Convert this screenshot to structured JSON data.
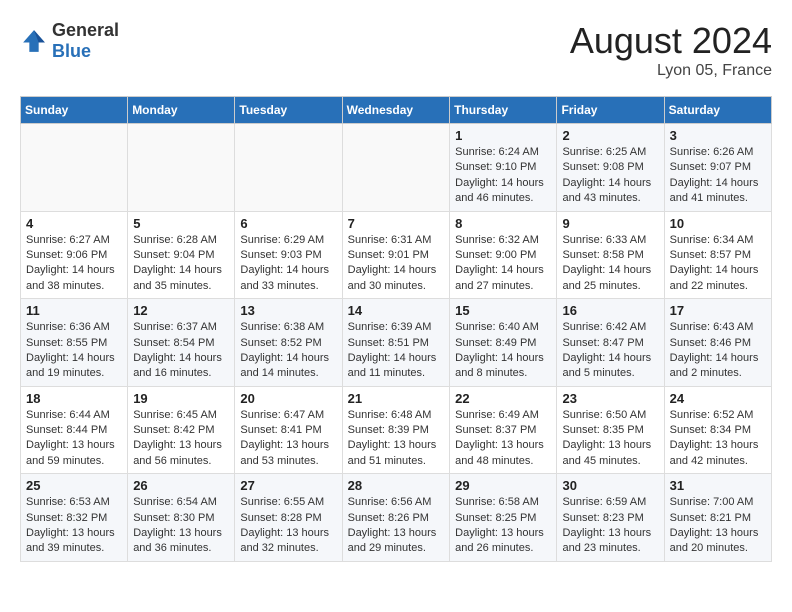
{
  "header": {
    "logo_general": "General",
    "logo_blue": "Blue",
    "month": "August 2024",
    "location": "Lyon 05, France"
  },
  "weekdays": [
    "Sunday",
    "Monday",
    "Tuesday",
    "Wednesday",
    "Thursday",
    "Friday",
    "Saturday"
  ],
  "weeks": [
    [
      {
        "day": "",
        "info": ""
      },
      {
        "day": "",
        "info": ""
      },
      {
        "day": "",
        "info": ""
      },
      {
        "day": "",
        "info": ""
      },
      {
        "day": "1",
        "info": "Sunrise: 6:24 AM\nSunset: 9:10 PM\nDaylight: 14 hours\nand 46 minutes."
      },
      {
        "day": "2",
        "info": "Sunrise: 6:25 AM\nSunset: 9:08 PM\nDaylight: 14 hours\nand 43 minutes."
      },
      {
        "day": "3",
        "info": "Sunrise: 6:26 AM\nSunset: 9:07 PM\nDaylight: 14 hours\nand 41 minutes."
      }
    ],
    [
      {
        "day": "4",
        "info": "Sunrise: 6:27 AM\nSunset: 9:06 PM\nDaylight: 14 hours\nand 38 minutes."
      },
      {
        "day": "5",
        "info": "Sunrise: 6:28 AM\nSunset: 9:04 PM\nDaylight: 14 hours\nand 35 minutes."
      },
      {
        "day": "6",
        "info": "Sunrise: 6:29 AM\nSunset: 9:03 PM\nDaylight: 14 hours\nand 33 minutes."
      },
      {
        "day": "7",
        "info": "Sunrise: 6:31 AM\nSunset: 9:01 PM\nDaylight: 14 hours\nand 30 minutes."
      },
      {
        "day": "8",
        "info": "Sunrise: 6:32 AM\nSunset: 9:00 PM\nDaylight: 14 hours\nand 27 minutes."
      },
      {
        "day": "9",
        "info": "Sunrise: 6:33 AM\nSunset: 8:58 PM\nDaylight: 14 hours\nand 25 minutes."
      },
      {
        "day": "10",
        "info": "Sunrise: 6:34 AM\nSunset: 8:57 PM\nDaylight: 14 hours\nand 22 minutes."
      }
    ],
    [
      {
        "day": "11",
        "info": "Sunrise: 6:36 AM\nSunset: 8:55 PM\nDaylight: 14 hours\nand 19 minutes."
      },
      {
        "day": "12",
        "info": "Sunrise: 6:37 AM\nSunset: 8:54 PM\nDaylight: 14 hours\nand 16 minutes."
      },
      {
        "day": "13",
        "info": "Sunrise: 6:38 AM\nSunset: 8:52 PM\nDaylight: 14 hours\nand 14 minutes."
      },
      {
        "day": "14",
        "info": "Sunrise: 6:39 AM\nSunset: 8:51 PM\nDaylight: 14 hours\nand 11 minutes."
      },
      {
        "day": "15",
        "info": "Sunrise: 6:40 AM\nSunset: 8:49 PM\nDaylight: 14 hours\nand 8 minutes."
      },
      {
        "day": "16",
        "info": "Sunrise: 6:42 AM\nSunset: 8:47 PM\nDaylight: 14 hours\nand 5 minutes."
      },
      {
        "day": "17",
        "info": "Sunrise: 6:43 AM\nSunset: 8:46 PM\nDaylight: 14 hours\nand 2 minutes."
      }
    ],
    [
      {
        "day": "18",
        "info": "Sunrise: 6:44 AM\nSunset: 8:44 PM\nDaylight: 13 hours\nand 59 minutes."
      },
      {
        "day": "19",
        "info": "Sunrise: 6:45 AM\nSunset: 8:42 PM\nDaylight: 13 hours\nand 56 minutes."
      },
      {
        "day": "20",
        "info": "Sunrise: 6:47 AM\nSunset: 8:41 PM\nDaylight: 13 hours\nand 53 minutes."
      },
      {
        "day": "21",
        "info": "Sunrise: 6:48 AM\nSunset: 8:39 PM\nDaylight: 13 hours\nand 51 minutes."
      },
      {
        "day": "22",
        "info": "Sunrise: 6:49 AM\nSunset: 8:37 PM\nDaylight: 13 hours\nand 48 minutes."
      },
      {
        "day": "23",
        "info": "Sunrise: 6:50 AM\nSunset: 8:35 PM\nDaylight: 13 hours\nand 45 minutes."
      },
      {
        "day": "24",
        "info": "Sunrise: 6:52 AM\nSunset: 8:34 PM\nDaylight: 13 hours\nand 42 minutes."
      }
    ],
    [
      {
        "day": "25",
        "info": "Sunrise: 6:53 AM\nSunset: 8:32 PM\nDaylight: 13 hours\nand 39 minutes."
      },
      {
        "day": "26",
        "info": "Sunrise: 6:54 AM\nSunset: 8:30 PM\nDaylight: 13 hours\nand 36 minutes."
      },
      {
        "day": "27",
        "info": "Sunrise: 6:55 AM\nSunset: 8:28 PM\nDaylight: 13 hours\nand 32 minutes."
      },
      {
        "day": "28",
        "info": "Sunrise: 6:56 AM\nSunset: 8:26 PM\nDaylight: 13 hours\nand 29 minutes."
      },
      {
        "day": "29",
        "info": "Sunrise: 6:58 AM\nSunset: 8:25 PM\nDaylight: 13 hours\nand 26 minutes."
      },
      {
        "day": "30",
        "info": "Sunrise: 6:59 AM\nSunset: 8:23 PM\nDaylight: 13 hours\nand 23 minutes."
      },
      {
        "day": "31",
        "info": "Sunrise: 7:00 AM\nSunset: 8:21 PM\nDaylight: 13 hours\nand 20 minutes."
      }
    ]
  ]
}
